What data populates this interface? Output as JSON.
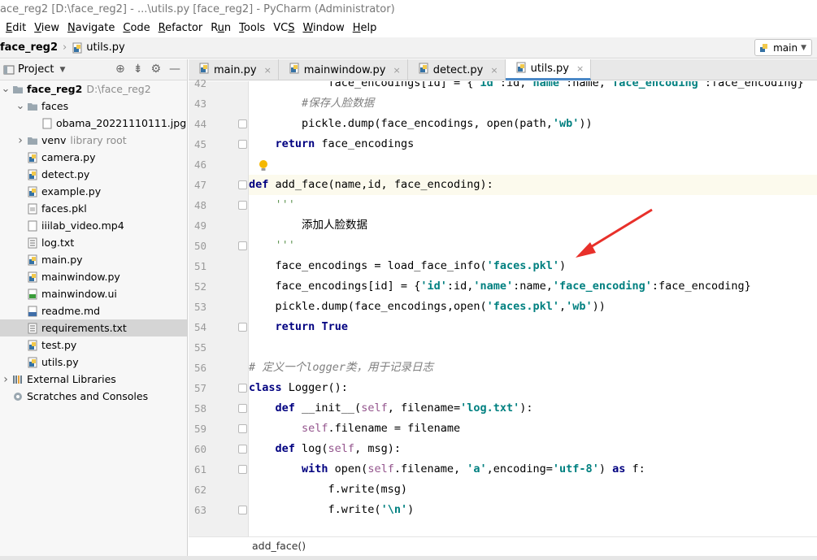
{
  "window": {
    "title": "ace_reg2 [D:\\face_reg2] - ...\\utils.py [face_reg2] - PyCharm (Administrator)"
  },
  "menu": [
    {
      "label": "Edit",
      "u": "E"
    },
    {
      "label": "View",
      "u": "V"
    },
    {
      "label": "Navigate",
      "u": "N"
    },
    {
      "label": "Code",
      "u": "C"
    },
    {
      "label": "Refactor",
      "u": "R"
    },
    {
      "label": "Run",
      "u": "u"
    },
    {
      "label": "Tools",
      "u": "T"
    },
    {
      "label": "VCS",
      "u": "S"
    },
    {
      "label": "Window",
      "u": "W"
    },
    {
      "label": "Help",
      "u": "H"
    }
  ],
  "nav": {
    "root": "face_reg2",
    "file": "utils.py",
    "run_config": "main"
  },
  "project": {
    "title": "Project",
    "tree": [
      {
        "label": "face_reg2",
        "extra": "D:\\face_reg2",
        "type": "folder",
        "depth": 0,
        "expanded": true,
        "bold": true
      },
      {
        "label": "faces",
        "type": "folder",
        "depth": 1,
        "expanded": true
      },
      {
        "label": "obama_20221110111.jpg",
        "type": "image",
        "depth": 2
      },
      {
        "label": "venv",
        "extra": "library root",
        "type": "folder",
        "depth": 1,
        "expanded": false
      },
      {
        "label": "camera.py",
        "type": "py",
        "depth": 1
      },
      {
        "label": "detect.py",
        "type": "py",
        "depth": 1
      },
      {
        "label": "example.py",
        "type": "py",
        "depth": 1
      },
      {
        "label": "faces.pkl",
        "type": "pkl",
        "depth": 1
      },
      {
        "label": "iiilab_video.mp4",
        "type": "file",
        "depth": 1
      },
      {
        "label": "log.txt",
        "type": "txt",
        "depth": 1
      },
      {
        "label": "main.py",
        "type": "py",
        "depth": 1
      },
      {
        "label": "mainwindow.py",
        "type": "py",
        "depth": 1
      },
      {
        "label": "mainwindow.ui",
        "type": "ui",
        "depth": 1
      },
      {
        "label": "readme.md",
        "type": "md",
        "depth": 1
      },
      {
        "label": "requirements.txt",
        "type": "txt",
        "depth": 1,
        "selected": true
      },
      {
        "label": "test.py",
        "type": "py",
        "depth": 1
      },
      {
        "label": "utils.py",
        "type": "py",
        "depth": 1
      },
      {
        "label": "External Libraries",
        "type": "lib",
        "depth": 0,
        "expanded": false
      },
      {
        "label": "Scratches and Consoles",
        "type": "scratch",
        "depth": 0
      }
    ]
  },
  "tabs": [
    {
      "label": "main.py",
      "active": false
    },
    {
      "label": "mainwindow.py",
      "active": false
    },
    {
      "label": "detect.py",
      "active": false
    },
    {
      "label": "utils.py",
      "active": true
    }
  ],
  "editor": {
    "lines": [
      {
        "no": "42",
        "html": "            face_encodings[id] = {'id':id,'name':name,'face_encoding':face_encoding}"
      },
      {
        "no": "43",
        "html": "        #保存人脸数据"
      },
      {
        "no": "44",
        "html": "        pickle.dump(face_encodings, open(path,'wb'))"
      },
      {
        "no": "45",
        "html": "    return face_encodings"
      },
      {
        "no": "46",
        "html": ""
      },
      {
        "no": "47",
        "html": "def add_face(name,id, face_encoding):"
      },
      {
        "no": "48",
        "html": "    '''"
      },
      {
        "no": "49",
        "html": "        添加人脸数据"
      },
      {
        "no": "50",
        "html": "    '''"
      },
      {
        "no": "51",
        "html": "    face_encodings = load_face_info('faces.pkl')"
      },
      {
        "no": "52",
        "html": "    face_encodings[id] = {'id':id,'name':name,'face_encoding':face_encoding}"
      },
      {
        "no": "53",
        "html": "    pickle.dump(face_encodings,open('faces.pkl','wb'))"
      },
      {
        "no": "54",
        "html": "    return True"
      },
      {
        "no": "55",
        "html": ""
      },
      {
        "no": "56",
        "html": "# 定义一个logger类，用于记录日志"
      },
      {
        "no": "57",
        "html": "class Logger():"
      },
      {
        "no": "58",
        "html": "    def __init__(self, filename='log.txt'):"
      },
      {
        "no": "59",
        "html": "        self.filename = filename"
      },
      {
        "no": "60",
        "html": "    def log(self, msg):"
      },
      {
        "no": "61",
        "html": "        with open(self.filename, 'a',encoding='utf-8') as f:"
      },
      {
        "no": "62",
        "html": "            f.write(msg)"
      },
      {
        "no": "63",
        "html": "            f.write('\\n')"
      }
    ]
  },
  "bottom_breadcrumb": "add_face()",
  "colors": {
    "accent": "#4a88c7",
    "annotation_arrow": "#e8302a"
  }
}
